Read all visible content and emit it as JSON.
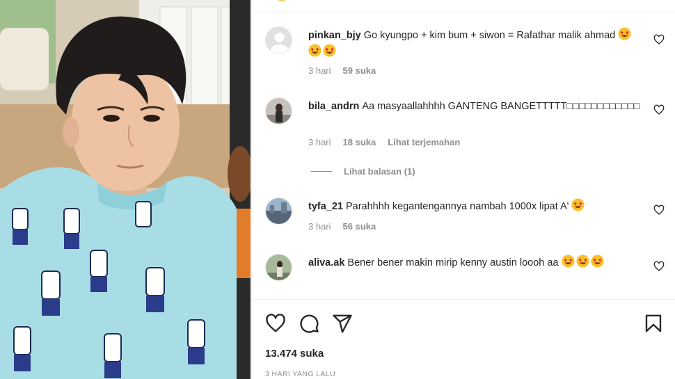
{
  "colors": {
    "text": "#262626",
    "secondary": "#8e8e8e",
    "divider": "#efefef",
    "cape": "#a8dde6"
  },
  "comments": [
    {
      "username": "pinkan_bjy",
      "text": "Go kyungpo + kim bum + siwon = Rafathar malik ahmad",
      "emojis": 3,
      "time": "3 hari",
      "likes": "59 suka",
      "translate": ""
    },
    {
      "username": "bila_andrn",
      "text": "Aa masyaallahhhh GANTENG BANGETTTTT□□□□□□□□□□□□",
      "emojis": 0,
      "time": "3 hari",
      "likes": "18 suka",
      "translate": "Lihat terjemahan",
      "replies": "Lihat balasan (1)"
    },
    {
      "username": "tyfa_21",
      "text": "Parahhhh kegantengannya nambah 1000x lipat A'",
      "emojis": 1,
      "time": "3 hari",
      "likes": "56 suka",
      "translate": ""
    },
    {
      "username": "aliva.ak",
      "text": "Bener bener makin mirip kenny austin loooh aa",
      "emojis": 3,
      "time": "",
      "likes": "",
      "translate": ""
    }
  ],
  "icons": {
    "like": "heart-icon",
    "comment": "comment-bubble-icon",
    "share": "paper-plane-icon",
    "save": "bookmark-icon"
  },
  "post": {
    "likes": "13.474 suka",
    "date": "3 HARI YANG LALU"
  }
}
